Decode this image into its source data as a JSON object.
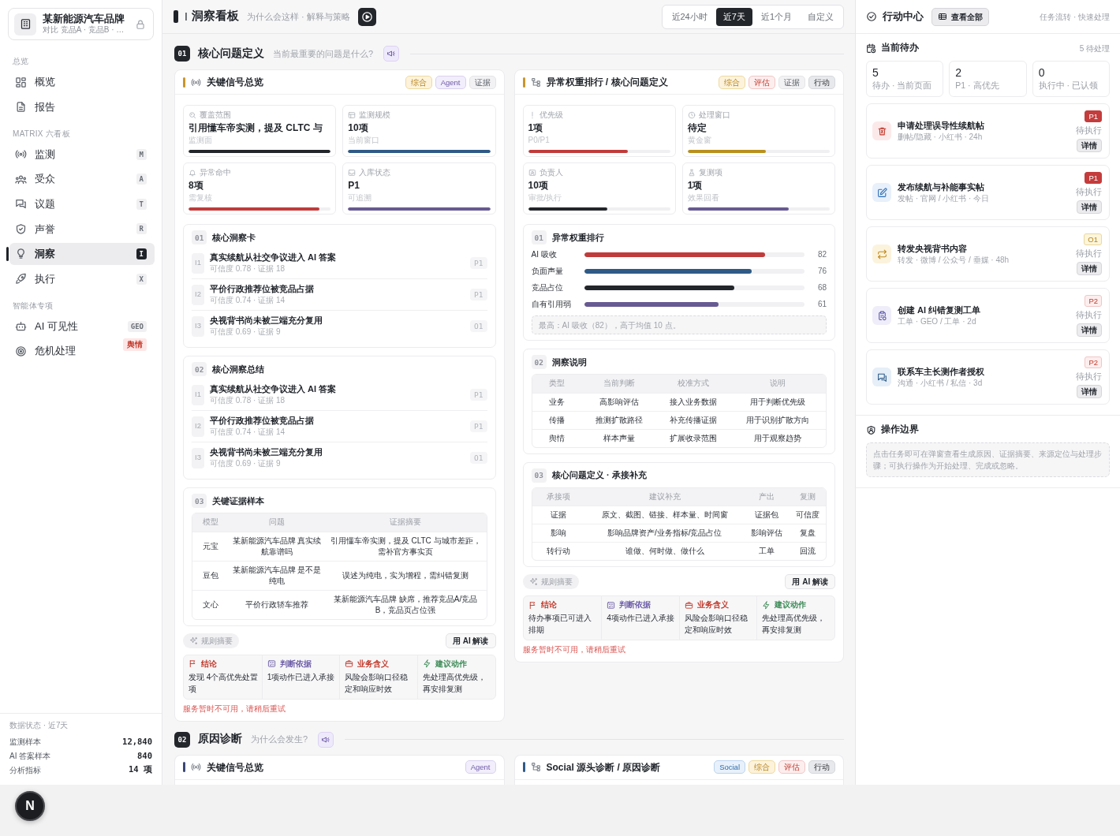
{
  "sidebar": {
    "brand": {
      "name": "某新能源汽车品牌",
      "subtitle": "对比 竞品A · 竞品B · …"
    },
    "groups": [
      {
        "title": "总览",
        "items": [
          {
            "label": "概览",
            "kind": "overview",
            "selected": false
          },
          {
            "label": "报告",
            "kind": "report",
            "selected": false
          }
        ]
      },
      {
        "title": "MATRIX 六看板",
        "items": [
          {
            "label": "监测",
            "kind": "monitor",
            "badge": "M",
            "alert": false,
            "selected": false
          },
          {
            "label": "受众",
            "kind": "audience",
            "badge": "A",
            "alert": false,
            "selected": false
          },
          {
            "label": "议题",
            "kind": "topic",
            "badge": "T",
            "alert": false,
            "selected": false
          },
          {
            "label": "声誉",
            "kind": "reputation",
            "badge": "R",
            "alert": false,
            "selected": false
          },
          {
            "label": "洞察",
            "kind": "insight",
            "badge": "I",
            "alert": false,
            "selected": true
          },
          {
            "label": "执行",
            "kind": "execute",
            "badge": "X",
            "alert": false,
            "selected": false
          }
        ]
      },
      {
        "title": "智能体专项",
        "items": [
          {
            "label": "AI 可见性",
            "kind": "geo",
            "badge": "GEO",
            "alert": false,
            "selected": false
          },
          {
            "label": "危机处理",
            "kind": "crisis",
            "badge": "舆情",
            "alert": true,
            "selected": false
          }
        ]
      }
    ],
    "data_status": {
      "title": "数据状态 · 近7天",
      "rows": [
        {
          "label": "监测样本",
          "value": "12,840"
        },
        {
          "label": "AI 答案样本",
          "value": "840"
        },
        {
          "label": "分析指标",
          "value": "14 项"
        }
      ]
    }
  },
  "header": {
    "code": "I",
    "title": "洞察看板",
    "subtitle": "为什么会这样 · 解释与策略",
    "ranges": [
      {
        "label": "近24小时",
        "selected": false
      },
      {
        "label": "近7天",
        "selected": true
      },
      {
        "label": "近1个月",
        "selected": false
      },
      {
        "label": "自定义",
        "selected": false
      }
    ]
  },
  "sections": [
    {
      "number": "01",
      "title": "核心问题定义",
      "question": "当前最重要的问题是什么?",
      "cards": [
        {
          "kind": "signal",
          "color": "#c9962c",
          "title": "关键信号总览",
          "tags": [
            {
              "label": "综合",
              "kind": "overall"
            },
            {
              "label": "Agent",
              "kind": "agent"
            },
            {
              "label": "证据",
              "kind": "evidence"
            }
          ],
          "metrics": [
            {
              "kind": "coverage",
              "label": "覆盖范围",
              "value": "引用懂车帝实测，提及 CLTC 与",
              "note": "监测面",
              "level": 1,
              "color": "#23262b"
            },
            {
              "kind": "scale",
              "label": "监测规模",
              "value": "10项",
              "note": "当前窗口",
              "level": 1,
              "color": "#2f5a86"
            },
            {
              "kind": "anomaly",
              "label": "异常命中",
              "value": "8项",
              "note": "需复核",
              "level": 0.92,
              "color": "#c03b3b"
            },
            {
              "kind": "storage",
              "label": "入库状态",
              "value": "P1",
              "note": "可追溯",
              "level": 1,
              "color": "#675a92"
            }
          ],
          "blocks": [
            {
              "kind": "insights",
              "number": "01",
              "title": "核心洞察卡",
              "items": [
                {
                  "code": "I1",
                  "title": "真实续航从社交争议进入 AI 答案",
                  "meta": "可信度 0.78 · 证据 18",
                  "priority": "P1"
                },
                {
                  "code": "I2",
                  "title": "平价行政推荐位被竞品占据",
                  "meta": "可信度 0.74 · 证据 14",
                  "priority": "P1"
                },
                {
                  "code": "I3",
                  "title": "央视背书尚未被三端充分复用",
                  "meta": "可信度 0.69 · 证据 9",
                  "priority": "O1"
                }
              ]
            },
            {
              "kind": "insights",
              "number": "02",
              "title": "核心洞察总结",
              "items": [
                {
                  "code": "I1",
                  "title": "真实续航从社交争议进入 AI 答案",
                  "meta": "可信度 0.78 · 证据 18",
                  "priority": "P1"
                },
                {
                  "code": "I2",
                  "title": "平价行政推荐位被竞品占据",
                  "meta": "可信度 0.74 · 证据 14",
                  "priority": "P1"
                },
                {
                  "code": "I3",
                  "title": "央视背书尚未被三端充分复用",
                  "meta": "可信度 0.69 · 证据 9",
                  "priority": "O1"
                }
              ]
            },
            {
              "kind": "table",
              "number": "03",
              "title": "关键证据样本",
              "columns": [
                "模型",
                "问题",
                "证据摘要"
              ],
              "rows": [
                [
                  "元宝",
                  "某新能源汽车品牌 真实续航靠谱吗",
                  "引用懂车帝实测，提及 CLTC 与城市差距，需补官方事实页"
                ],
                [
                  "豆包",
                  "某新能源汽车品牌 是不是纯电",
                  "误述为纯电，实为增程，需纠错复测"
                ],
                [
                  "文心",
                  "平价行政轿车推荐",
                  "某新能源汽车品牌 缺席，推荐竞品A/竞品B，竞品页占位强"
                ]
              ]
            }
          ],
          "rule_label": "规则摘要",
          "ai_label": "用 AI 解读",
          "summary": [
            {
              "kind": "conclusion",
              "label": "结论",
              "text": "发现 4个高优先处置项"
            },
            {
              "kind": "basis",
              "label": "判断依据",
              "text": "1项动作已进入承接"
            },
            {
              "kind": "meaning",
              "label": "业务含义",
              "text": "风险会影响口径稳定和响应时效"
            },
            {
              "kind": "action",
              "label": "建议动作",
              "text": "先处理高优先级，再安排复测"
            }
          ],
          "error": "服务暂时不可用，请稍后重试"
        },
        {
          "kind": "structure",
          "color": "#c9962c",
          "title": "异常权重排行 / 核心问题定义",
          "tags": [
            {
              "label": "综合",
              "kind": "overall"
            },
            {
              "label": "评估",
              "kind": "assess"
            },
            {
              "label": "证据",
              "kind": "evidence"
            },
            {
              "label": "行动",
              "kind": "action"
            }
          ],
          "metrics": [
            {
              "kind": "priority",
              "label": "优先级",
              "value": "1项",
              "note": "P0/P1",
              "level": 0.7,
              "color": "#c03b3b"
            },
            {
              "kind": "window",
              "label": "处理窗口",
              "value": "待定",
              "note": "黄金窗",
              "level": 0.55,
              "color": "#b8901c"
            },
            {
              "kind": "owner",
              "label": "负责人",
              "value": "10项",
              "note": "审批/执行",
              "level": 0.56,
              "color": "#23262b"
            },
            {
              "kind": "retest",
              "label": "复测项",
              "value": "1项",
              "note": "效果回看",
              "level": 0.71,
              "color": "#675a92"
            }
          ],
          "blocks": [
            {
              "kind": "ranking",
              "number": "01",
              "title": "异常权重排行",
              "items": [
                {
                  "label": "AI 吸收",
                  "level": 0.82,
                  "reading": "82",
                  "color": "#c03b3b"
                },
                {
                  "label": "负面声量",
                  "level": 0.76,
                  "reading": "76",
                  "color": "#2f5a86"
                },
                {
                  "label": "竞品占位",
                  "level": 0.68,
                  "reading": "68",
                  "color": "#23262b"
                },
                {
                  "label": "自有引用弱",
                  "level": 0.61,
                  "reading": "61",
                  "color": "#675a92"
                }
              ],
              "note": "最高：AI 吸收（82），高于均值 10 点。"
            },
            {
              "kind": "table",
              "number": "02",
              "title": "洞察说明",
              "columns": [
                "类型",
                "当前判断",
                "校准方式",
                "说明"
              ],
              "rows": [
                [
                  "业务",
                  "高影响评估",
                  "接入业务数据",
                  "用于判断优先级"
                ],
                [
                  "传播",
                  "推测扩散路径",
                  "补充传播证据",
                  "用于识别扩散方向"
                ],
                [
                  "舆情",
                  "样本声量",
                  "扩展收录范围",
                  "用于观察趋势"
                ]
              ]
            },
            {
              "kind": "table",
              "number": "03",
              "title": "核心问题定义 · 承接补充",
              "columns": [
                "承接项",
                "建议补充",
                "产出",
                "复测"
              ],
              "rows": [
                [
                  "证据",
                  "原文、截图、链接、样本量、时间窗",
                  "证据包",
                  "可信度"
                ],
                [
                  "影响",
                  "影响品牌资产/业务指标/竞品占位",
                  "影响评估",
                  "复盘"
                ],
                [
                  "转行动",
                  "谁做、何时做、做什么",
                  "工单",
                  "回流"
                ]
              ]
            }
          ],
          "rule_label": "规则摘要",
          "ai_label": "用 AI 解读",
          "summary": [
            {
              "kind": "conclusion",
              "label": "结论",
              "text": "待办事项已可进入排期"
            },
            {
              "kind": "basis",
              "label": "判断依据",
              "text": "4项动作已进入承接"
            },
            {
              "kind": "meaning",
              "label": "业务含义",
              "text": "风险会影响口径稳定和响应时效"
            },
            {
              "kind": "action",
              "label": "建议动作",
              "text": "先处理高优先级，再安排复测"
            }
          ],
          "error": "服务暂时不可用，请稍后重试"
        }
      ]
    },
    {
      "number": "02",
      "title": "原因诊断",
      "question": "为什么会发生?",
      "cards": [
        {
          "kind": "signal",
          "color": "#3b4775",
          "title": "关键信号总览",
          "tags": [
            {
              "label": "Agent",
              "kind": "agent"
            }
          ]
        },
        {
          "kind": "structure",
          "color": "#2f5a86",
          "title": "Social 源头诊断 / 原因诊断",
          "tags": [
            {
              "label": "Social",
              "kind": "social"
            },
            {
              "label": "综合",
              "kind": "overall"
            },
            {
              "label": "评估",
              "kind": "assess"
            },
            {
              "label": "行动",
              "kind": "action"
            }
          ]
        }
      ]
    }
  ],
  "action_center": {
    "title": "行动中心",
    "view_all": "查看全部",
    "caption": "任务流转 · 快速处理",
    "todo": {
      "title": "当前待办",
      "count": "5 待处理",
      "stats": [
        {
          "value": "5",
          "label": "待办 · 当前页面"
        },
        {
          "value": "2",
          "label": "P1 · 高优先"
        },
        {
          "value": "0",
          "label": "执行中 · 已认领"
        }
      ],
      "tasks": [
        {
          "kind": "delete",
          "title": "申请处理误导性续航帖",
          "meta": "删帖/隐藏 · 小红书 · 24h",
          "priority": {
            "label": "P1",
            "kind": "critical"
          },
          "status": "待执行",
          "action": "详情"
        },
        {
          "kind": "publish",
          "title": "发布续航与补能事实帖",
          "meta": "发帖 · 官网 / 小红书 · 今日",
          "priority": {
            "label": "P1",
            "kind": "critical"
          },
          "status": "待执行",
          "action": "详情"
        },
        {
          "kind": "repost",
          "title": "转发央视背书内容",
          "meta": "转发 · 微博 / 公众号 / 垂媒 · 48h",
          "priority": {
            "label": "O1",
            "kind": "opportunity"
          },
          "status": "待执行",
          "action": "详情"
        },
        {
          "kind": "ticket",
          "title": "创建 AI 纠错复测工单",
          "meta": "工单 · GEO / 工单 · 2d",
          "priority": {
            "label": "P2",
            "kind": "normal"
          },
          "status": "待执行",
          "action": "详情"
        },
        {
          "kind": "contact",
          "title": "联系车主长测作者授权",
          "meta": "沟通 · 小红书 / 私信 · 3d",
          "priority": {
            "label": "P2",
            "kind": "normal"
          },
          "status": "待执行",
          "action": "详情"
        }
      ]
    },
    "boundary": {
      "title": "操作边界",
      "text": "点击任务即可在弹窗查看生成原因、证据摘要、来源定位与处理步骤；可执行操作为开始处理、完成或忽略。"
    }
  },
  "floating_button": {
    "label": "N"
  }
}
